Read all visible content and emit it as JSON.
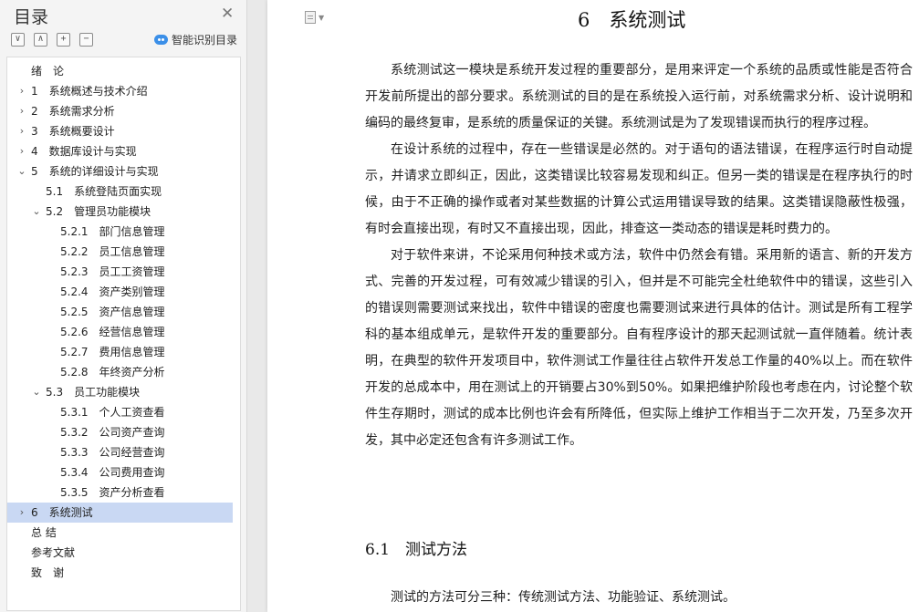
{
  "toc": {
    "title": "目录",
    "smart_label": "智能识别目录",
    "tools": [
      "∨",
      "∧",
      "+",
      "−"
    ],
    "items": [
      {
        "num": "",
        "label": "绪　论",
        "level": 0,
        "chevron": ""
      },
      {
        "num": "1",
        "label": "系统概述与技术介绍",
        "level": 0,
        "chevron": "›"
      },
      {
        "num": "2",
        "label": "系统需求分析",
        "level": 0,
        "chevron": "›"
      },
      {
        "num": "3",
        "label": "系统概要设计",
        "level": 0,
        "chevron": "›"
      },
      {
        "num": "4",
        "label": "数据库设计与实现",
        "level": 0,
        "chevron": "›"
      },
      {
        "num": "5",
        "label": "系统的详细设计与实现",
        "level": 0,
        "chevron": "⌄"
      },
      {
        "num": "5.1",
        "label": "系统登陆页面实现",
        "level": 1,
        "chevron": ""
      },
      {
        "num": "5.2",
        "label": "管理员功能模块",
        "level": 1,
        "chevron": "⌄"
      },
      {
        "num": "5.2.1",
        "label": "部门信息管理",
        "level": 2,
        "chevron": ""
      },
      {
        "num": "5.2.2",
        "label": "员工信息管理",
        "level": 2,
        "chevron": ""
      },
      {
        "num": "5.2.3",
        "label": "员工工资管理",
        "level": 2,
        "chevron": ""
      },
      {
        "num": "5.2.4",
        "label": "资产类别管理",
        "level": 2,
        "chevron": ""
      },
      {
        "num": "5.2.5",
        "label": "资产信息管理",
        "level": 2,
        "chevron": ""
      },
      {
        "num": "5.2.6",
        "label": "经营信息管理",
        "level": 2,
        "chevron": ""
      },
      {
        "num": "5.2.7",
        "label": "费用信息管理",
        "level": 2,
        "chevron": ""
      },
      {
        "num": "5.2.8",
        "label": "年终资产分析",
        "level": 2,
        "chevron": ""
      },
      {
        "num": "5.3",
        "label": "员工功能模块",
        "level": 1,
        "chevron": "⌄"
      },
      {
        "num": "5.3.1",
        "label": "个人工资查看",
        "level": 2,
        "chevron": ""
      },
      {
        "num": "5.3.2",
        "label": "公司资产查询",
        "level": 2,
        "chevron": ""
      },
      {
        "num": "5.3.3",
        "label": "公司经营查询",
        "level": 2,
        "chevron": ""
      },
      {
        "num": "5.3.4",
        "label": "公司费用查询",
        "level": 2,
        "chevron": ""
      },
      {
        "num": "5.3.5",
        "label": "资产分析查看",
        "level": 2,
        "chevron": ""
      },
      {
        "num": "6",
        "label": "系统测试",
        "level": 0,
        "chevron": "›",
        "active": true
      },
      {
        "num": "",
        "label": "总 结",
        "level": 0,
        "chevron": ""
      },
      {
        "num": "",
        "label": "参考文献",
        "level": 0,
        "chevron": ""
      },
      {
        "num": "",
        "label": "致　谢",
        "level": 0,
        "chevron": ""
      }
    ]
  },
  "doc": {
    "chapter_title": "6　系统测试",
    "paragraphs": [
      "系统测试这一模块是系统开发过程的重要部分，是用来评定一个系统的品质或性能是否符合开发前所提出的部分要求。系统测试的目的是在系统投入运行前，对系统需求分析、设计说明和编码的最终复审，是系统的质量保证的关键。系统测试是为了发现错误而执行的程序过程。",
      "在设计系统的过程中，存在一些错误是必然的。对于语句的语法错误，在程序运行时自动提示，并请求立即纠正，因此，这类错误比较容易发现和纠正。但另一类的错误是在程序执行的时候，由于不正确的操作或者对某些数据的计算公式运用错误导致的结果。这类错误隐蔽性极强，有时会直接出现，有时又不直接出现，因此，排查这一类动态的错误是耗时费力的。",
      "对于软件来讲，不论采用何种技术或方法，软件中仍然会有错。采用新的语言、新的开发方式、完善的开发过程，可有效减少错误的引入，但并是不可能完全杜绝软件中的错误，这些引入的错误则需要测试来找出，软件中错误的密度也需要测试来进行具体的估计。测试是所有工程学科的基本组成单元，是软件开发的重要部分。自有程序设计的那天起测试就一直伴随着。统计表明，在典型的软件开发项目中，软件测试工作量往往占软件开发总工作量的40%以上。而在软件开发的总成本中，用在测试上的开销要占30%到50%。如果把维护阶段也考虑在内，讨论整个软件生存期时，测试的成本比例也许会有所降低，但实际上维护工作相当于二次开发，乃至多次开发，其中必定还包含有许多测试工作。"
    ],
    "section_title": "6.1　测试方法",
    "section_paragraph": "测试的方法可分三种：传统测试方法、功能验证、系统测试。"
  }
}
